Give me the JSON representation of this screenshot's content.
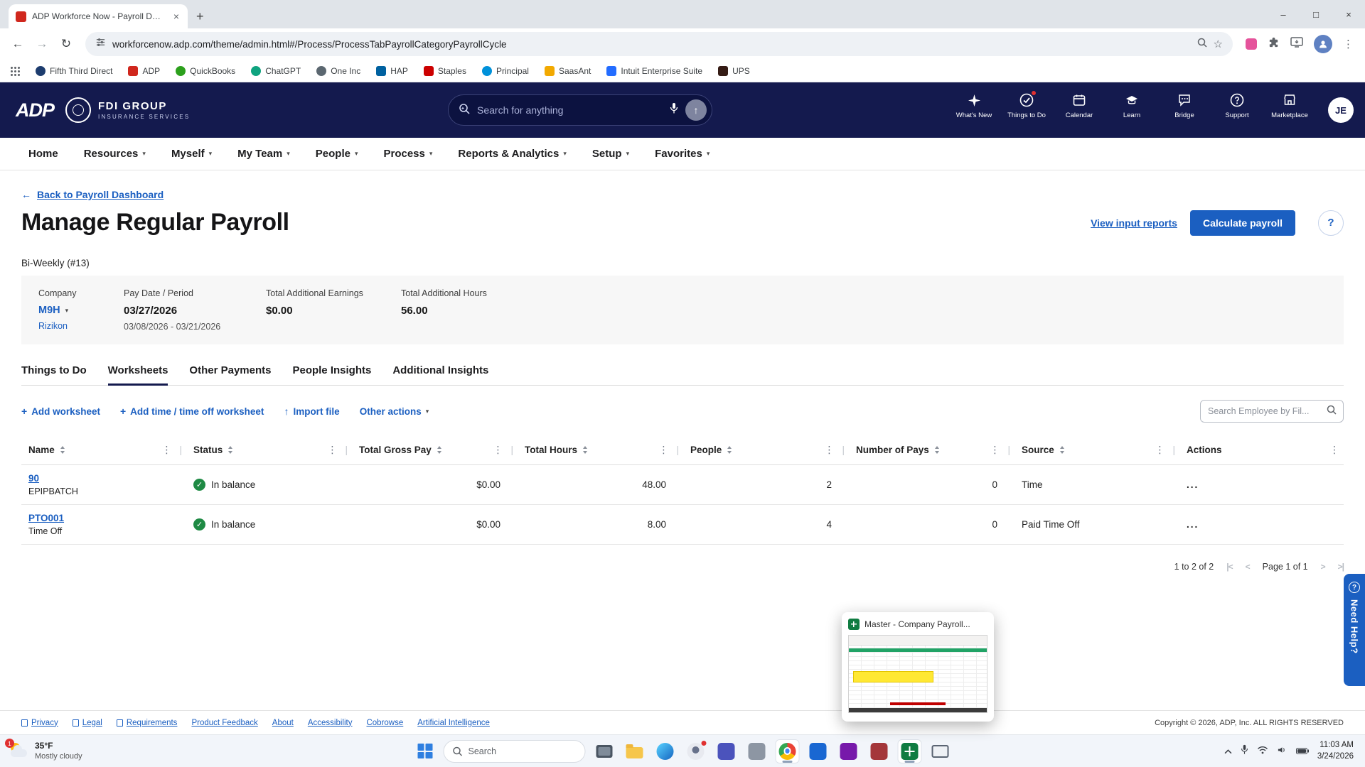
{
  "colors": {
    "navy": "#141a4e",
    "accent": "#1b5fc1",
    "success": "#1e8a44",
    "danger": "#e03131"
  },
  "icons": {
    "minimize": "–",
    "maximize": "□",
    "close": "×",
    "tab_close": "×",
    "new_tab": "+",
    "back": "←",
    "forward": "→",
    "reload": "↻",
    "star": "☆",
    "menu": "⋮",
    "plus": "+",
    "caret_down": "▾",
    "kebab": "⋮",
    "divider": "|",
    "ellipsis": "...",
    "check": "✓",
    "import_arrow": "↑",
    "send_arrow": "↑",
    "question": "?",
    "page_first": "|<",
    "page_prev": "<",
    "page_next": ">",
    "page_last": ">|"
  },
  "browser": {
    "tab_title": "ADP Workforce Now - Payroll D…",
    "url": "workforcenow.adp.com/theme/admin.html#/Process/ProcessTabPayrollCategoryPayrollCycle",
    "bookmarks": [
      {
        "label": "Fifth Third Direct",
        "color": "#1d3c6e"
      },
      {
        "label": "ADP",
        "color": "#d0271d"
      },
      {
        "label": "QuickBooks",
        "color": "#2ca01c"
      },
      {
        "label": "ChatGPT",
        "color": "#0fa37f"
      },
      {
        "label": "One Inc",
        "color": "#5b6770"
      },
      {
        "label": "HAP",
        "color": "#0061a0"
      },
      {
        "label": "Staples",
        "color": "#cc0000"
      },
      {
        "label": "Principal",
        "color": "#0091da"
      },
      {
        "label": "SaasAnt",
        "color": "#f2a900"
      },
      {
        "label": "Intuit Enterprise Suite",
        "color": "#236cff"
      },
      {
        "label": "UPS",
        "color": "#351c15"
      }
    ]
  },
  "header": {
    "logo_text": "ADP",
    "brand_line1": "FDI GROUP",
    "brand_line2": "INSURANCE SERVICES",
    "search_placeholder": "Search for anything",
    "nav_icons": [
      {
        "label": "What's New"
      },
      {
        "label": "Things to Do"
      },
      {
        "label": "Calendar"
      },
      {
        "label": "Learn"
      },
      {
        "label": "Bridge"
      },
      {
        "label": "Support"
      },
      {
        "label": "Marketplace"
      }
    ],
    "avatar_initials": "JE"
  },
  "nav": {
    "items": [
      {
        "label": "Home"
      },
      {
        "label": "Resources"
      },
      {
        "label": "Myself"
      },
      {
        "label": "My Team"
      },
      {
        "label": "People"
      },
      {
        "label": "Process"
      },
      {
        "label": "Reports & Analytics"
      },
      {
        "label": "Setup"
      },
      {
        "label": "Favorites"
      }
    ]
  },
  "page": {
    "back_link": "Back to Payroll Dashboard",
    "title": "Manage Regular Payroll",
    "view_reports_link": "View input reports",
    "calculate_button": "Calculate payroll",
    "cycle_label": "Bi-Weekly (#13)",
    "summary": {
      "company_label": "Company",
      "company_value": "M9H",
      "company_sub": "Rizikon",
      "pay_label": "Pay Date / Period",
      "pay_value": "03/27/2026",
      "pay_sub": "03/08/2026 - 03/21/2026",
      "earnings_label": "Total Additional Earnings",
      "earnings_value": "$0.00",
      "hours_label": "Total Additional Hours",
      "hours_value": "56.00"
    },
    "tabs": [
      {
        "label": "Things to Do",
        "active": false
      },
      {
        "label": "Worksheets",
        "active": true
      },
      {
        "label": "Other Payments",
        "active": false
      },
      {
        "label": "People Insights",
        "active": false
      },
      {
        "label": "Additional Insights",
        "active": false
      }
    ],
    "actions": {
      "add_worksheet": "Add worksheet",
      "add_time": "Add time / time off worksheet",
      "import_file": "Import file",
      "other_actions": "Other actions",
      "search_placeholder": "Search Employee by Fil..."
    },
    "table": {
      "columns": [
        "Name",
        "Status",
        "Total Gross Pay",
        "Total Hours",
        "People",
        "Number of Pays",
        "Source",
        "Actions"
      ],
      "rows": [
        {
          "name": "90",
          "name_sub": "EPIPBATCH",
          "status": "In balance",
          "gross": "$0.00",
          "hours": "48.00",
          "people": "2",
          "pays": "0",
          "source": "Time"
        },
        {
          "name": "PTO001",
          "name_sub": "Time Off",
          "status": "In balance",
          "gross": "$0.00",
          "hours": "8.00",
          "people": "4",
          "pays": "0",
          "source": "Paid Time Off"
        }
      ]
    },
    "pagination": {
      "range": "1 to 2 of 2",
      "page": "Page 1 of 1"
    }
  },
  "footer": {
    "links": [
      "Privacy",
      "Legal",
      "Requirements",
      "Product Feedback",
      "About",
      "Accessibility",
      "Cobrowse",
      "Artificial Intelligence"
    ],
    "copyright": "Copyright © 2026, ADP, Inc. ALL RIGHTS RESERVED"
  },
  "preview": {
    "title": "Master - Company Payroll..."
  },
  "help_tab": "Need Help?",
  "taskbar": {
    "weather_badge": "1",
    "weather_temp": "35°F",
    "weather_condition": "Mostly cloudy",
    "search_placeholder": "Search",
    "time": "11:03 AM",
    "date": "3/24/2026"
  }
}
